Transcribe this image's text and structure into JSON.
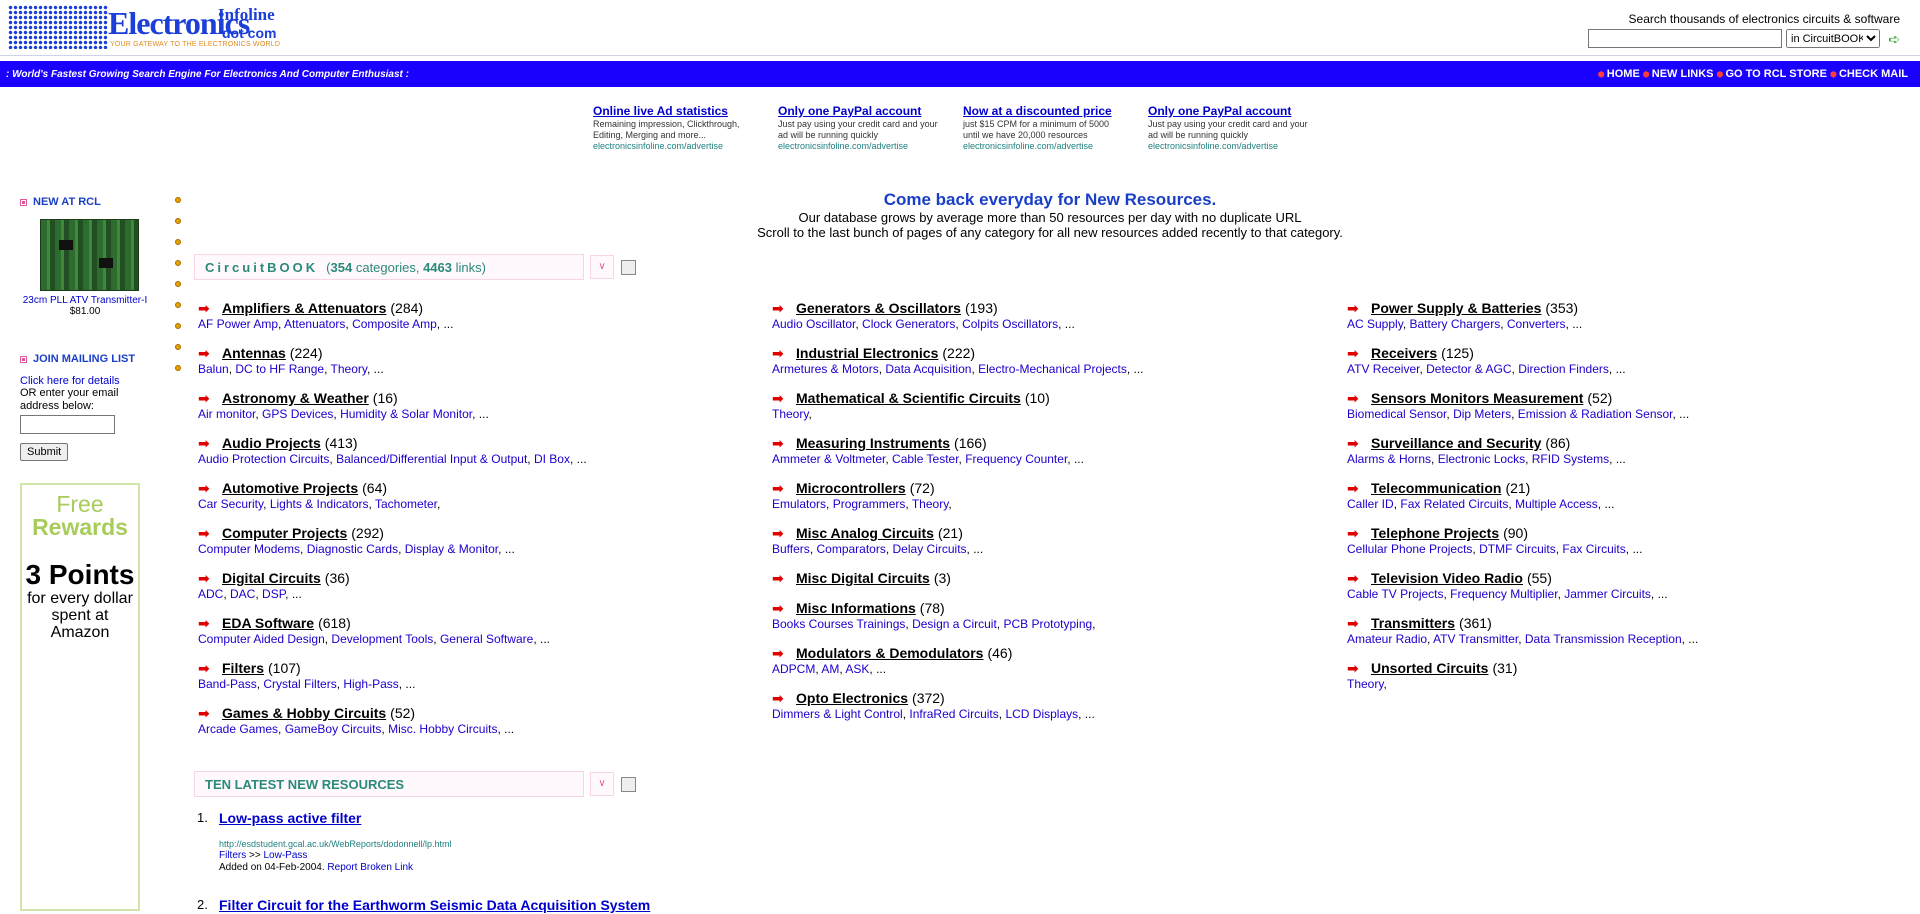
{
  "header": {
    "logo_main": "Electronics",
    "logo_sup": "Infoline",
    "logo_dot": "dot com",
    "logo_tagline": "YOUR GATEWAY TO THE ELECTRONICS WORLD",
    "search_label": "Search thousands of electronics circuits & software",
    "search_value": "",
    "search_scope": "in CircuitBOOK",
    "go_icon": "go-arrow-icon"
  },
  "navbar": {
    "tagline": ":  World's Fastest Growing Search Engine For Electronics And Computer Enthusiast  :",
    "links": [
      "HOME",
      "NEW LINKS",
      "GO TO RCL STORE",
      "CHECK MAIL"
    ],
    "bg_color": "#1a00ff"
  },
  "ads": [
    {
      "title": "Online live Ad statistics",
      "text": "Remaining impression, Clickthrough, Editing, Merging and more...",
      "url": "electronicsinfoline.com/advertise"
    },
    {
      "title": "Only one PayPal account",
      "text": "Just pay using your credit card and your ad will be running quickly",
      "url": "electronicsinfoline.com/advertise"
    },
    {
      "title": "Now at a discounted price",
      "text": "just $15 CPM for a minimum of 5000 until we have 20,000 resources",
      "url": "electronicsinfoline.com/advertise"
    },
    {
      "title": "Only one PayPal account",
      "text": "Just pay using your credit card and your ad will be running quickly",
      "url": "electronicsinfoline.com/advertise"
    }
  ],
  "sidebar": {
    "new_heading": "NEW AT RCL",
    "product_name": "23cm PLL ATV Transmitter-I",
    "product_price": "$81.00",
    "mailing_heading": "JOIN MAILING LIST",
    "mailing_link": "Click here for details",
    "mailing_text": "OR enter your email address below:",
    "email_value": "",
    "submit_label": "Submit",
    "rewards_free": "Free",
    "rewards_word": "Rewards",
    "rewards_points": "3 Points",
    "rewards_text": "for every dollar spent at Amazon"
  },
  "intro": {
    "headline": "Come back everyday for New Resources.",
    "line1": "Our database grows by average more than 50 resources per day with no duplicate URL",
    "line2": "Scroll to the last bunch of pages of any category for all new resources added recently to that category."
  },
  "circuitbook": {
    "title": "CircuitBOOK",
    "open_paren": "(",
    "categories_count": "354",
    "categories_word": "categories,",
    "links_count": "4463",
    "links_word": "links)",
    "toggle_icon": "chevron-down-icon"
  },
  "categories": {
    "col1": [
      {
        "name": "Amplifiers & Attenuators",
        "count": "(284)",
        "subs": [
          "AF Power Amp",
          "Attenuators",
          "Composite Amp"
        ],
        "tail": "..."
      },
      {
        "name": "Antennas",
        "count": "(224)",
        "subs": [
          "Balun",
          "DC to HF Range",
          "Theory"
        ],
        "tail": "..."
      },
      {
        "name": "Astronomy & Weather",
        "count": "(16)",
        "subs": [
          "Air monitor",
          "GPS Devices",
          "Humidity & Solar Monitor"
        ],
        "tail": "..."
      },
      {
        "name": "Audio Projects",
        "count": "(413)",
        "subs": [
          "Audio Protection Circuits",
          "Balanced/Differential Input & Output",
          "DI Box"
        ],
        "tail": "..."
      },
      {
        "name": "Automotive Projects",
        "count": "(64)",
        "subs": [
          "Car Security",
          "Lights & Indicators",
          "Tachometer"
        ],
        "tail": ""
      },
      {
        "name": "Computer Projects",
        "count": "(292)",
        "subs": [
          "Computer Modems",
          "Diagnostic Cards",
          "Display & Monitor"
        ],
        "tail": "..."
      },
      {
        "name": "Digital Circuits",
        "count": "(36)",
        "subs": [
          "ADC",
          "DAC",
          "DSP"
        ],
        "tail": "..."
      },
      {
        "name": "EDA Software",
        "count": "(618)",
        "subs": [
          "Computer Aided Design",
          "Development Tools",
          "General Software"
        ],
        "tail": "..."
      },
      {
        "name": "Filters",
        "count": "(107)",
        "subs": [
          "Band-Pass",
          "Crystal Filters",
          "High-Pass"
        ],
        "tail": "..."
      },
      {
        "name": "Games & Hobby Circuits",
        "count": "(52)",
        "subs": [
          "Arcade Games",
          "GameBoy Circuits",
          "Misc. Hobby Circuits"
        ],
        "tail": "..."
      }
    ],
    "col2": [
      {
        "name": "Generators & Oscillators",
        "count": "(193)",
        "subs": [
          "Audio Oscillator",
          "Clock Generators",
          "Colpits Oscillators"
        ],
        "tail": "..."
      },
      {
        "name": "Industrial Electronics",
        "count": "(222)",
        "subs": [
          "Armetures & Motors",
          "Data Acquisition",
          "Electro-Mechanical Projects"
        ],
        "tail": "..."
      },
      {
        "name": "Mathematical & Scientific Circuits",
        "count": "(10)",
        "subs": [
          "Theory"
        ],
        "tail": ""
      },
      {
        "name": "Measuring Instruments",
        "count": "(166)",
        "subs": [
          "Ammeter & Voltmeter",
          "Cable Tester",
          "Frequency Counter"
        ],
        "tail": "..."
      },
      {
        "name": "Microcontrollers",
        "count": "(72)",
        "subs": [
          "Emulators",
          "Programmers",
          "Theory"
        ],
        "tail": ""
      },
      {
        "name": "Misc Analog Circuits",
        "count": "(21)",
        "subs": [
          "Buffers",
          "Comparators",
          "Delay Circuits"
        ],
        "tail": "..."
      },
      {
        "name": "Misc Digital Circuits",
        "count": "(3)",
        "subs": [],
        "tail": ""
      },
      {
        "name": "Misc Informations",
        "count": "(78)",
        "subs": [
          "Books Courses Trainings",
          "Design a Circuit",
          "PCB Prototyping"
        ],
        "tail": ""
      },
      {
        "name": "Modulators & Demodulators",
        "count": "(46)",
        "subs": [
          "ADPCM",
          "AM",
          "ASK"
        ],
        "tail": "..."
      },
      {
        "name": "Opto Electronics",
        "count": "(372)",
        "subs": [
          "Dimmers & Light Control",
          "InfraRed Circuits",
          "LCD Displays"
        ],
        "tail": "..."
      }
    ],
    "col3": [
      {
        "name": "Power Supply & Batteries",
        "count": "(353)",
        "subs": [
          "AC Supply",
          "Battery Chargers",
          "Converters"
        ],
        "tail": "..."
      },
      {
        "name": "Receivers",
        "count": "(125)",
        "subs": [
          "ATV Receiver",
          "Detector & AGC",
          "Direction Finders"
        ],
        "tail": "..."
      },
      {
        "name": "Sensors Monitors Measurement",
        "count": "(52)",
        "subs": [
          "Biomedical Sensor",
          "Dip Meters",
          "Emission & Radiation Sensor"
        ],
        "tail": "..."
      },
      {
        "name": "Surveillance and Security",
        "count": "(86)",
        "subs": [
          "Alarms & Horns",
          "Electronic Locks",
          "RFID Systems"
        ],
        "tail": "..."
      },
      {
        "name": "Telecommunication",
        "count": "(21)",
        "subs": [
          "Caller ID",
          "Fax Related Circuits",
          "Multiple Access"
        ],
        "tail": "..."
      },
      {
        "name": "Telephone Projects",
        "count": "(90)",
        "subs": [
          "Cellular Phone Projects",
          "DTMF Circuits",
          "Fax Circuits"
        ],
        "tail": "..."
      },
      {
        "name": "Television Video Radio",
        "count": "(55)",
        "subs": [
          "Cable TV Projects",
          "Frequency Multiplier",
          "Jammer Circuits"
        ],
        "tail": "..."
      },
      {
        "name": "Transmitters",
        "count": "(361)",
        "subs": [
          "Amateur Radio",
          "ATV Transmitter",
          "Data Transmission Reception"
        ],
        "tail": "..."
      },
      {
        "name": "Unsorted Circuits",
        "count": "(31)",
        "subs": [
          "Theory"
        ],
        "tail": ""
      }
    ]
  },
  "latest": {
    "title": "TEN LATEST NEW RESOURCES",
    "items": [
      {
        "num": "1.",
        "title": "Low-pass active filter",
        "url": "http://esdstudent.gcal.ac.uk/WebReports/dodonnell/lp.html",
        "path1": "Filters",
        "sep": ">>",
        "path2": "Low-Pass",
        "date": "Added on 04-Feb-2004.",
        "report": "Report Broken Link"
      },
      {
        "num": "2.",
        "title": "Filter Circuit for the Earthworm Seismic Data Acquisition System"
      }
    ]
  }
}
